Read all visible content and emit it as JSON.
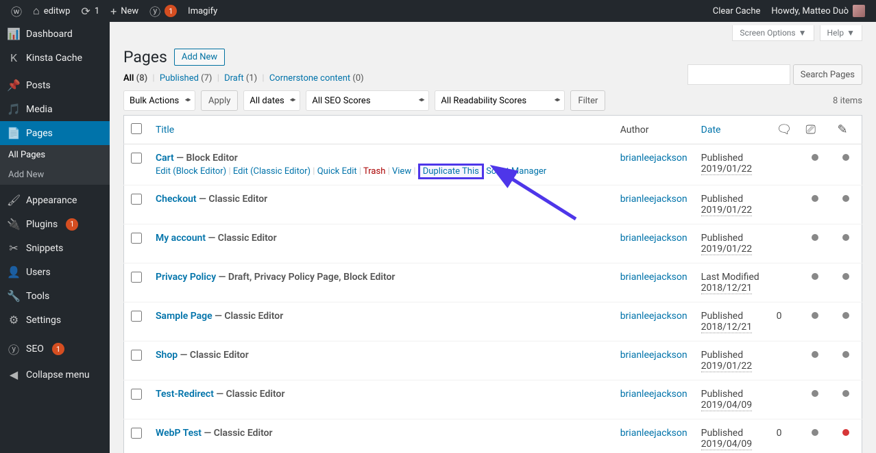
{
  "adminBar": {
    "site": "editwp",
    "updates": "1",
    "new": "New",
    "yoastBadge": "1",
    "imagify": "Imagify",
    "clearCache": "Clear Cache",
    "howdy": "Howdy, Matteo Duò"
  },
  "sidebar": {
    "items": [
      {
        "icon": "dashboard",
        "label": "Dashboard"
      },
      {
        "icon": "kinsta",
        "label": "Kinsta Cache"
      },
      {
        "icon": "pin",
        "label": "Posts"
      },
      {
        "icon": "media",
        "label": "Media"
      },
      {
        "icon": "pages",
        "label": "Pages",
        "current": true
      },
      {
        "icon": "appearance",
        "label": "Appearance"
      },
      {
        "icon": "plugins",
        "label": "Plugins",
        "badge": "1"
      },
      {
        "icon": "snippets",
        "label": "Snippets"
      },
      {
        "icon": "users",
        "label": "Users"
      },
      {
        "icon": "tools",
        "label": "Tools"
      },
      {
        "icon": "settings",
        "label": "Settings"
      },
      {
        "icon": "seo",
        "label": "SEO",
        "badge": "1"
      },
      {
        "icon": "collapse",
        "label": "Collapse menu"
      }
    ],
    "submenu": {
      "allPages": "All Pages",
      "addNew": "Add New"
    }
  },
  "screenMeta": {
    "screenOptions": "Screen Options",
    "help": "Help"
  },
  "heading": {
    "title": "Pages",
    "addNew": "Add New"
  },
  "views": {
    "all": {
      "label": "All",
      "count": "(8)"
    },
    "published": {
      "label": "Published",
      "count": "(7)"
    },
    "draft": {
      "label": "Draft",
      "count": "(1)"
    },
    "cornerstone": {
      "label": "Cornerstone content",
      "count": "(0)"
    }
  },
  "search": {
    "button": "Search Pages"
  },
  "filters": {
    "bulk": "Bulk Actions",
    "apply": "Apply",
    "dates": "All dates",
    "seo": "All SEO Scores",
    "read": "All Readability Scores",
    "filter": "Filter",
    "itemsCount": "8 items"
  },
  "columns": {
    "title": "Title",
    "author": "Author",
    "date": "Date"
  },
  "rowActions": {
    "editBlock": "Edit (Block Editor)",
    "editClassic": "Edit (Classic Editor)",
    "quickEdit": "Quick Edit",
    "trash": "Trash",
    "view": "View",
    "duplicate": "Duplicate This",
    "scriptMgr": "Script Manager"
  },
  "rows": [
    {
      "title": "Cart",
      "state": " — Block Editor",
      "author": "brianleejackson",
      "datePrefix": "Published",
      "date": "2019/01/22",
      "comments": "",
      "seo": "grey",
      "read": "grey",
      "showActions": true
    },
    {
      "title": "Checkout",
      "state": " — Classic Editor",
      "author": "brianleejackson",
      "datePrefix": "Published",
      "date": "2019/01/22",
      "comments": "",
      "seo": "grey",
      "read": "grey"
    },
    {
      "title": "My account",
      "state": " — Classic Editor",
      "author": "brianleejackson",
      "datePrefix": "Published",
      "date": "2019/01/22",
      "comments": "",
      "seo": "grey",
      "read": "grey"
    },
    {
      "title": "Privacy Policy",
      "state": " — Draft, Privacy Policy Page, Block Editor",
      "author": "brianleejackson",
      "datePrefix": "Last Modified",
      "date": "2018/12/21",
      "comments": "",
      "seo": "grey",
      "read": "grey"
    },
    {
      "title": "Sample Page",
      "state": " — Classic Editor",
      "author": "brianleejackson",
      "datePrefix": "Published",
      "date": "2018/12/21",
      "comments": "0",
      "seo": "grey",
      "read": "grey"
    },
    {
      "title": "Shop",
      "state": " — Classic Editor",
      "author": "brianleejackson",
      "datePrefix": "Published",
      "date": "2019/01/22",
      "comments": "",
      "seo": "grey",
      "read": "grey"
    },
    {
      "title": "Test-Redirect",
      "state": " — Classic Editor",
      "author": "brianleejackson",
      "datePrefix": "Published",
      "date": "2019/04/09",
      "comments": "",
      "seo": "grey",
      "read": "grey"
    },
    {
      "title": "WebP Test",
      "state": " — Classic Editor",
      "author": "brianleejackson",
      "datePrefix": "Published",
      "date": "2019/04/09",
      "comments": "0",
      "seo": "grey",
      "read": "red"
    }
  ]
}
